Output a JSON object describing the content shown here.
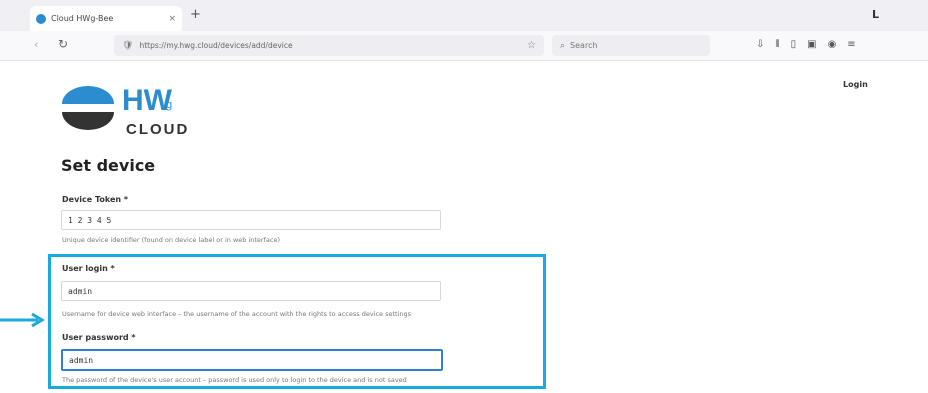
{
  "browser": {
    "tab_title": "Cloud HWg-Bee",
    "tab_close": "×",
    "new_tab": "+",
    "window_button": "L",
    "back": "‹",
    "reload": "↻",
    "url": "https://my.hwg.cloud/devices/add/device",
    "search_placeholder": "Search",
    "toolbar_icons": [
      "download-icon",
      "library-icon",
      "sidebar-icon",
      "screenshot-icon",
      "account-icon",
      "menu-icon"
    ]
  },
  "header": {
    "logo_brand": "HW",
    "logo_sub": "g",
    "logo_text": "CLOUD",
    "language": "Login"
  },
  "page": {
    "title": "Set device"
  },
  "form": {
    "device_id": {
      "label": "Device Token *",
      "value": "1 2 3 4 5",
      "help": "Unique device identifier (found on device label or in web interface)"
    },
    "user_login": {
      "label": "User login *",
      "value": "admin",
      "help": "Username for device web interface – the username of the account with the rights to access device settings"
    },
    "user_password": {
      "label": "User password *",
      "value": "admin",
      "help": "The password of the device's user account – password is used only to login to the device and is not saved"
    }
  },
  "colors": {
    "highlight": "#19aadf",
    "focus": "#2f7fd9",
    "logo_blue": "#2b8ccf",
    "logo_dark": "#333333"
  }
}
